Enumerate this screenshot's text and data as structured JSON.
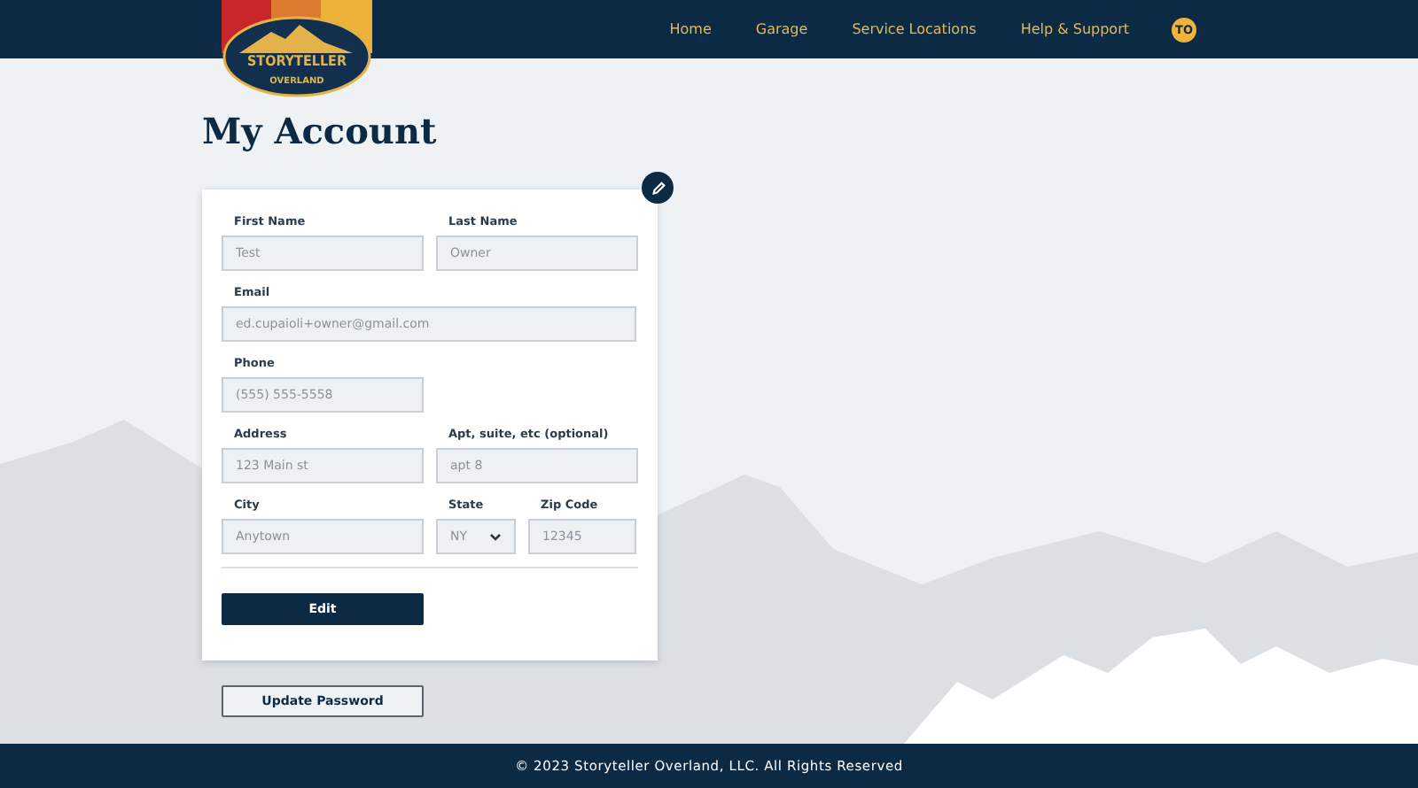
{
  "logo": {
    "title": "STORYTELLER",
    "subtitle": "OVERLAND"
  },
  "nav": [
    {
      "label": "Home"
    },
    {
      "label": "Garage"
    },
    {
      "label": "Service Locations"
    },
    {
      "label": "Help & Support"
    }
  ],
  "avatar": {
    "initials": "TO"
  },
  "page_title": "My Account",
  "form": {
    "rows": [
      [
        {
          "label": "First Name",
          "value": "Test",
          "kind": "text"
        },
        {
          "label": "Last Name",
          "value": "Owner",
          "kind": "text"
        }
      ],
      [
        {
          "label": "Email",
          "value": "ed.cupaioli+owner@gmail.com",
          "kind": "email"
        }
      ],
      [
        {
          "label": "Phone",
          "value": "(555) 555-5558",
          "kind": "tel"
        }
      ],
      [
        {
          "label": "Address",
          "value": "123 Main st",
          "kind": "text"
        },
        {
          "label": "Apt, suite, etc (optional)",
          "value": "apt 8",
          "kind": "text"
        }
      ],
      [
        {
          "label": "City",
          "value": "Anytown",
          "kind": "text"
        },
        {
          "label": "State",
          "value": "NY",
          "kind": "select"
        },
        {
          "label": "Zip Code",
          "value": "12345",
          "kind": "zip"
        }
      ]
    ],
    "submit": "Edit"
  },
  "password_button": "Update Password",
  "footer": "© 2023 Storyteller Overland, LLC. All Rights Reserved"
}
